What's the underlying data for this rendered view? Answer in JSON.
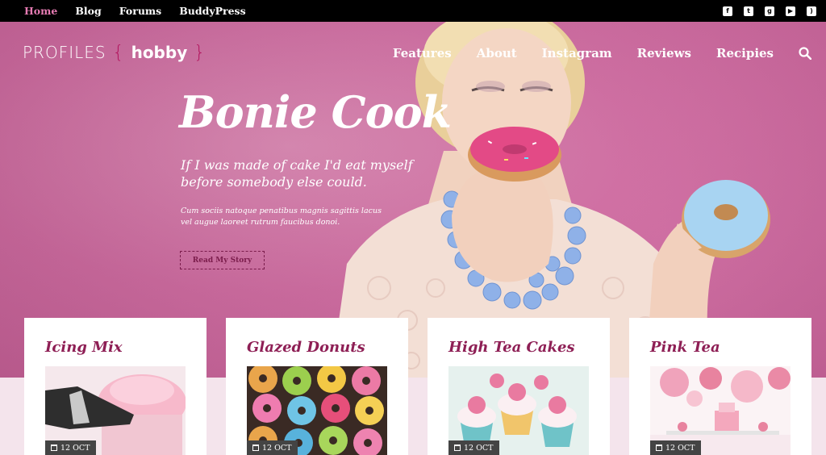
{
  "topbar": {
    "links": [
      "Home",
      "Blog",
      "Forums",
      "BuddyPress"
    ],
    "active": "Home",
    "social_icons": [
      "facebook-icon",
      "twitter-icon",
      "google-plus-icon",
      "youtube-icon",
      "rss-icon"
    ]
  },
  "logo": {
    "brand": "PROFILES",
    "brace_open": "{",
    "word": "hobby",
    "brace_close": "}"
  },
  "nav": {
    "items": [
      "Features",
      "About",
      "Instagram",
      "Reviews",
      "Recipies"
    ],
    "search_icon": "search-icon"
  },
  "hero": {
    "headline": "Bonie Cook",
    "tagline": "If I was made of cake I'd eat myself before somebody else could.",
    "blurb": "Cum sociis natoque penatibus magnis sagittis lacus vel augue laoreet rutrum faucibus donoi.",
    "button": "Read My Story"
  },
  "cards": [
    {
      "title": "Icing Mix",
      "date": "12 OCT"
    },
    {
      "title": "Glazed Donuts",
      "date": "12 OCT"
    },
    {
      "title": "High Tea Cakes",
      "date": "12 OCT"
    },
    {
      "title": "Pink Tea",
      "date": "12 OCT"
    }
  ],
  "colors": {
    "accent": "#8e1f55",
    "active_link": "#e67cb3",
    "hero_pink": "#cf6aa0",
    "topbar": "#000000"
  }
}
